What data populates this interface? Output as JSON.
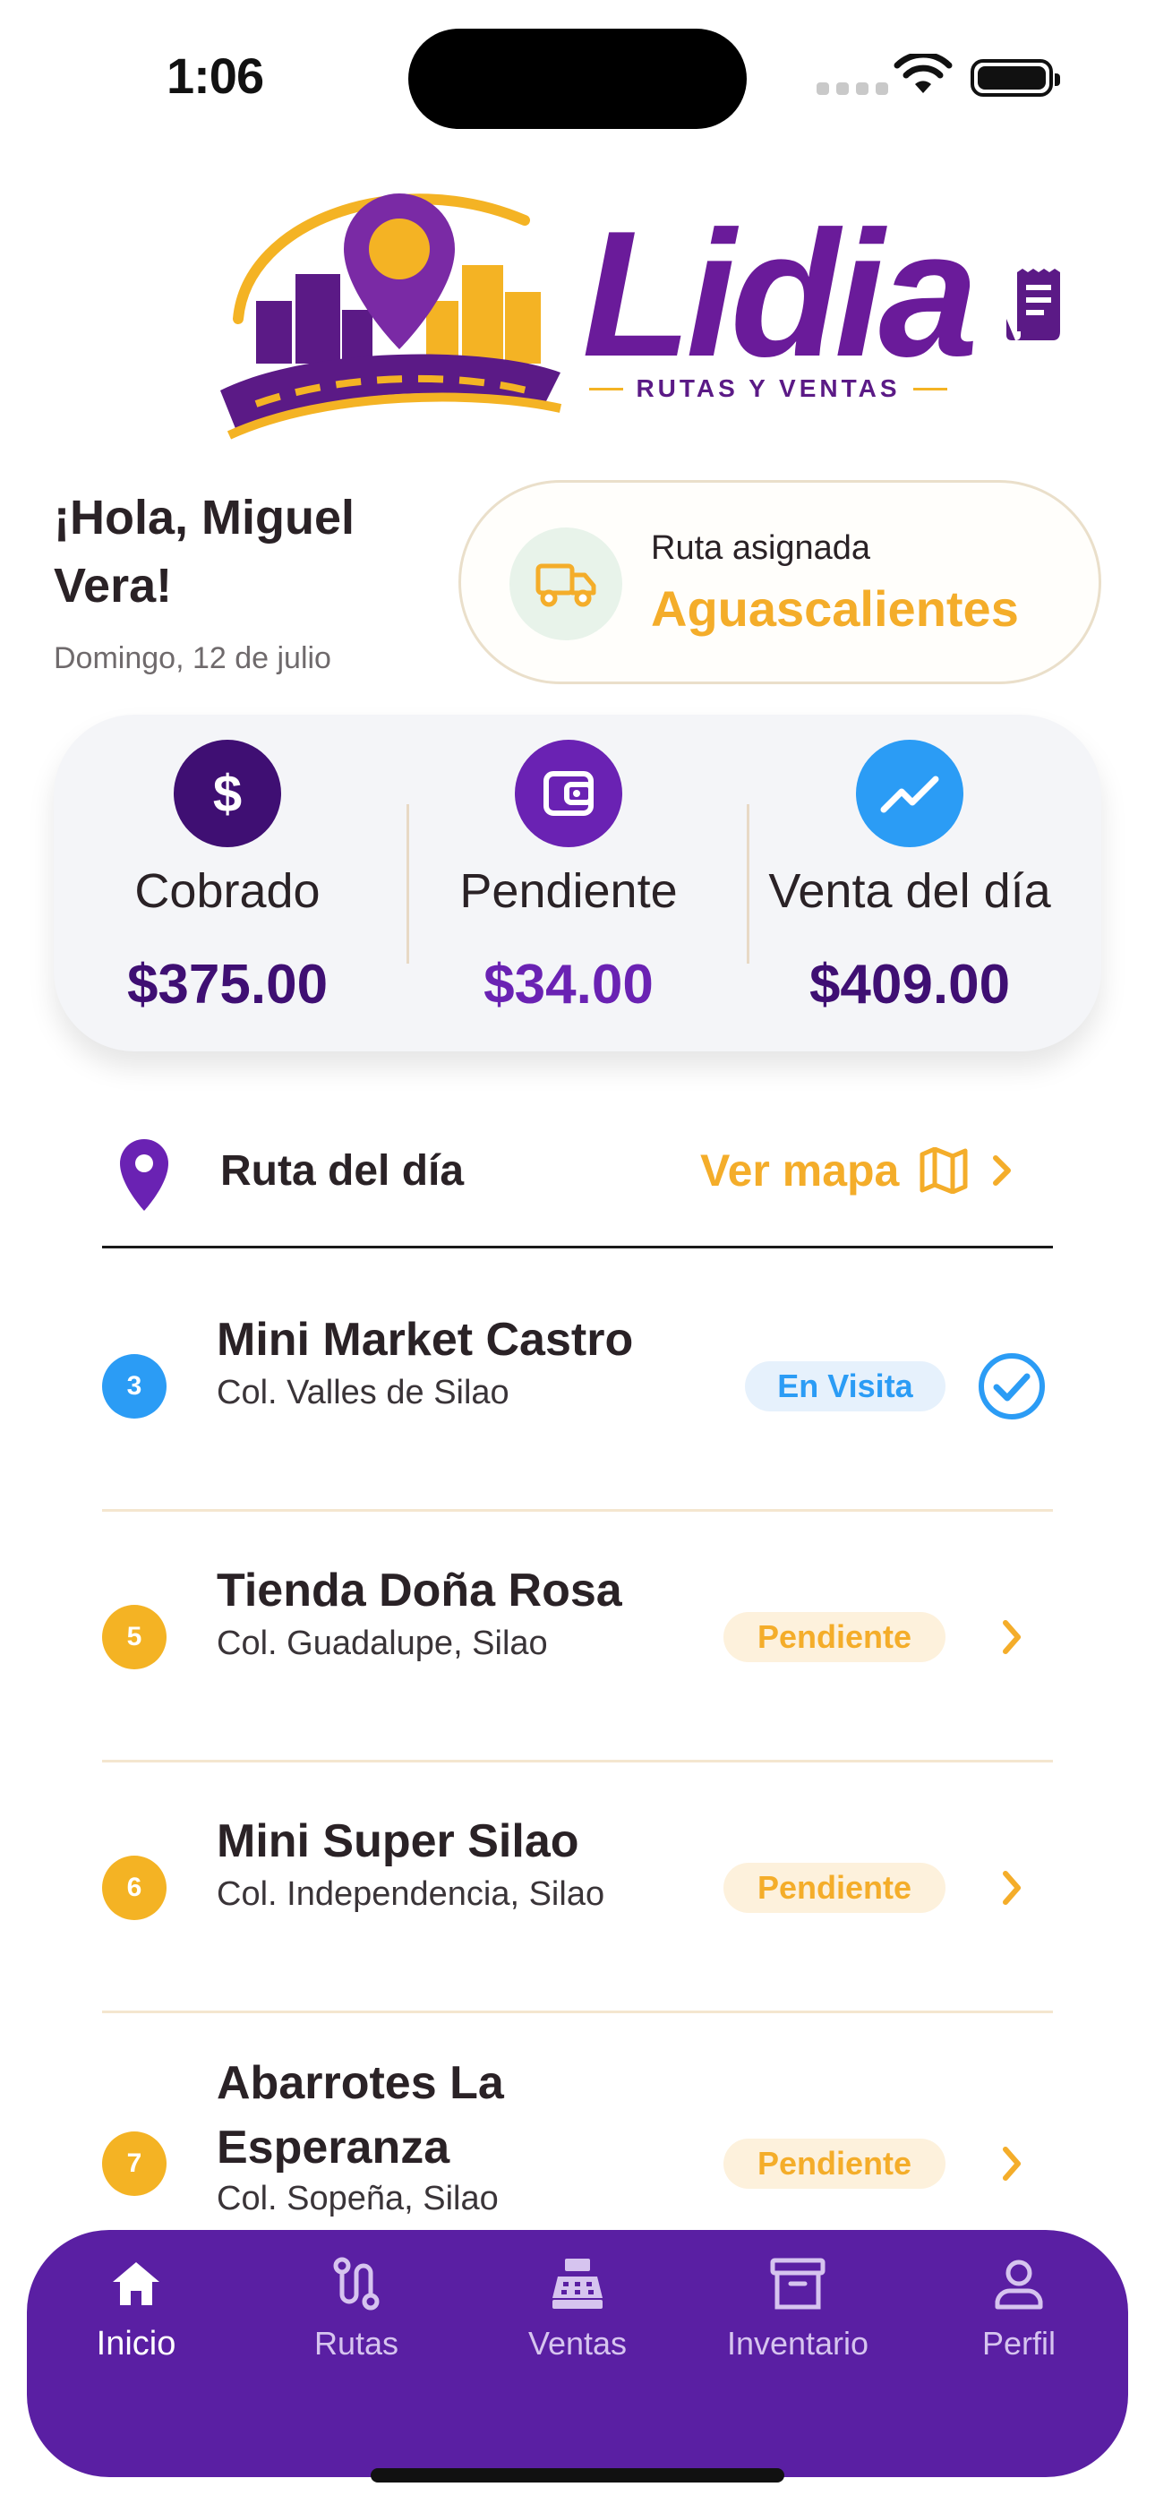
{
  "status_bar": {
    "time": "1:06"
  },
  "logo": {
    "name": "Lidia",
    "subtitle": "RUTAS Y VENTAS"
  },
  "header": {
    "greeting": "¡Hola, Miguel Vera!",
    "date": "Domingo, 12 de julio"
  },
  "route_card": {
    "label": "Ruta asignada",
    "city": "Aguascalientes"
  },
  "summary": [
    {
      "label": "Cobrado",
      "value": "$375.00",
      "icon": "dollar-icon",
      "color": "#3f0f73"
    },
    {
      "label": "Pendiente",
      "value": "$34.00",
      "icon": "wallet-icon",
      "color": "#6a22b3"
    },
    {
      "label": "Venta del día",
      "value": "$409.00",
      "icon": "trend-up-icon",
      "color": "#2b9cf5"
    }
  ],
  "route_of_day": {
    "title": "Ruta del día",
    "map_link": "Ver mapa"
  },
  "stops": [
    {
      "number": "3",
      "name": "Mini Market Castro",
      "address": "Col. Valles de Silao",
      "status": "En Visita",
      "num_color": "#2b9cf5"
    },
    {
      "number": "5",
      "name": "Tienda Doña Rosa",
      "address": "Col. Guadalupe, Silao",
      "status": "Pendiente",
      "num_color": "#f4b324"
    },
    {
      "number": "6",
      "name": "Mini Super Silao",
      "address": "Col. Independencia, Silao",
      "status": "Pendiente",
      "num_color": "#f4b324"
    },
    {
      "number": "7",
      "name": "Abarrotes La Esperanza",
      "address": "Col. Sopeña, Silao",
      "status": "Pendiente",
      "num_color": "#f4b324"
    }
  ],
  "nav": [
    {
      "label": "Inicio",
      "icon": "home-icon",
      "active": true
    },
    {
      "label": "Rutas",
      "icon": "route-icon",
      "active": false
    },
    {
      "label": "Ventas",
      "icon": "cash-register-icon",
      "active": false
    },
    {
      "label": "Inventario",
      "icon": "archive-box-icon",
      "active": false
    },
    {
      "label": "Perfil",
      "icon": "user-icon",
      "active": false
    }
  ],
  "colors": {
    "primary_purple": "#5a1fa3",
    "accent_yellow": "#f4ad2a",
    "info_blue": "#2b9cf5"
  }
}
